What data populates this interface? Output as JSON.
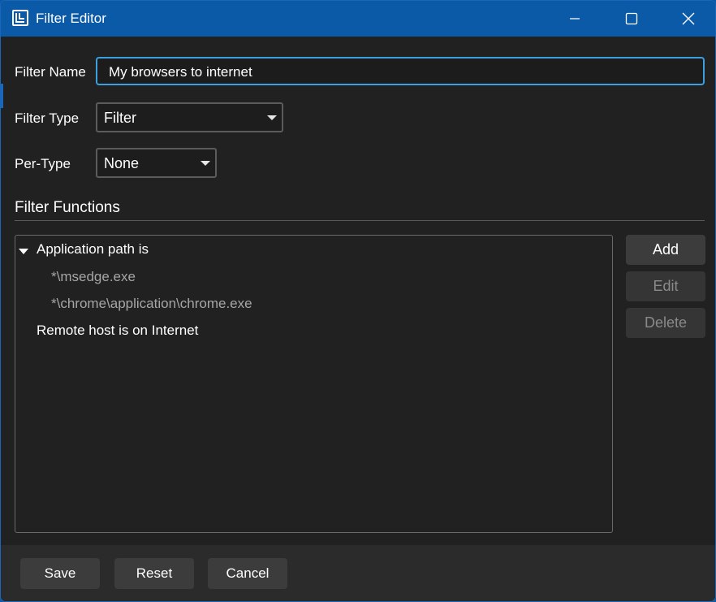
{
  "window": {
    "title": "Filter Editor"
  },
  "form": {
    "filter_name_label": "Filter Name",
    "filter_name_value": "My browsers to internet",
    "filter_type_label": "Filter Type",
    "filter_type_value": "Filter",
    "per_type_label": "Per-Type",
    "per_type_value": "None"
  },
  "functions": {
    "section_title": "Filter Functions",
    "tree": [
      {
        "label": "Application path is",
        "expanded": true,
        "children": [
          "*\\msedge.exe",
          "*\\chrome\\application\\chrome.exe"
        ]
      },
      {
        "label": "Remote host is on Internet"
      }
    ],
    "buttons": {
      "add": "Add",
      "edit": "Edit",
      "delete": "Delete"
    }
  },
  "footer": {
    "save": "Save",
    "reset": "Reset",
    "cancel": "Cancel"
  },
  "colors": {
    "titlebar": "#0b5aa8",
    "background": "#212121",
    "focus_border": "#3aa0e0"
  },
  "icons": {
    "app": "app-logo-icon",
    "minimize": "minimize-icon",
    "maximize": "maximize-icon",
    "close": "close-icon",
    "expander": "chevron-down-icon",
    "dropdown": "dropdown-arrow-icon"
  }
}
